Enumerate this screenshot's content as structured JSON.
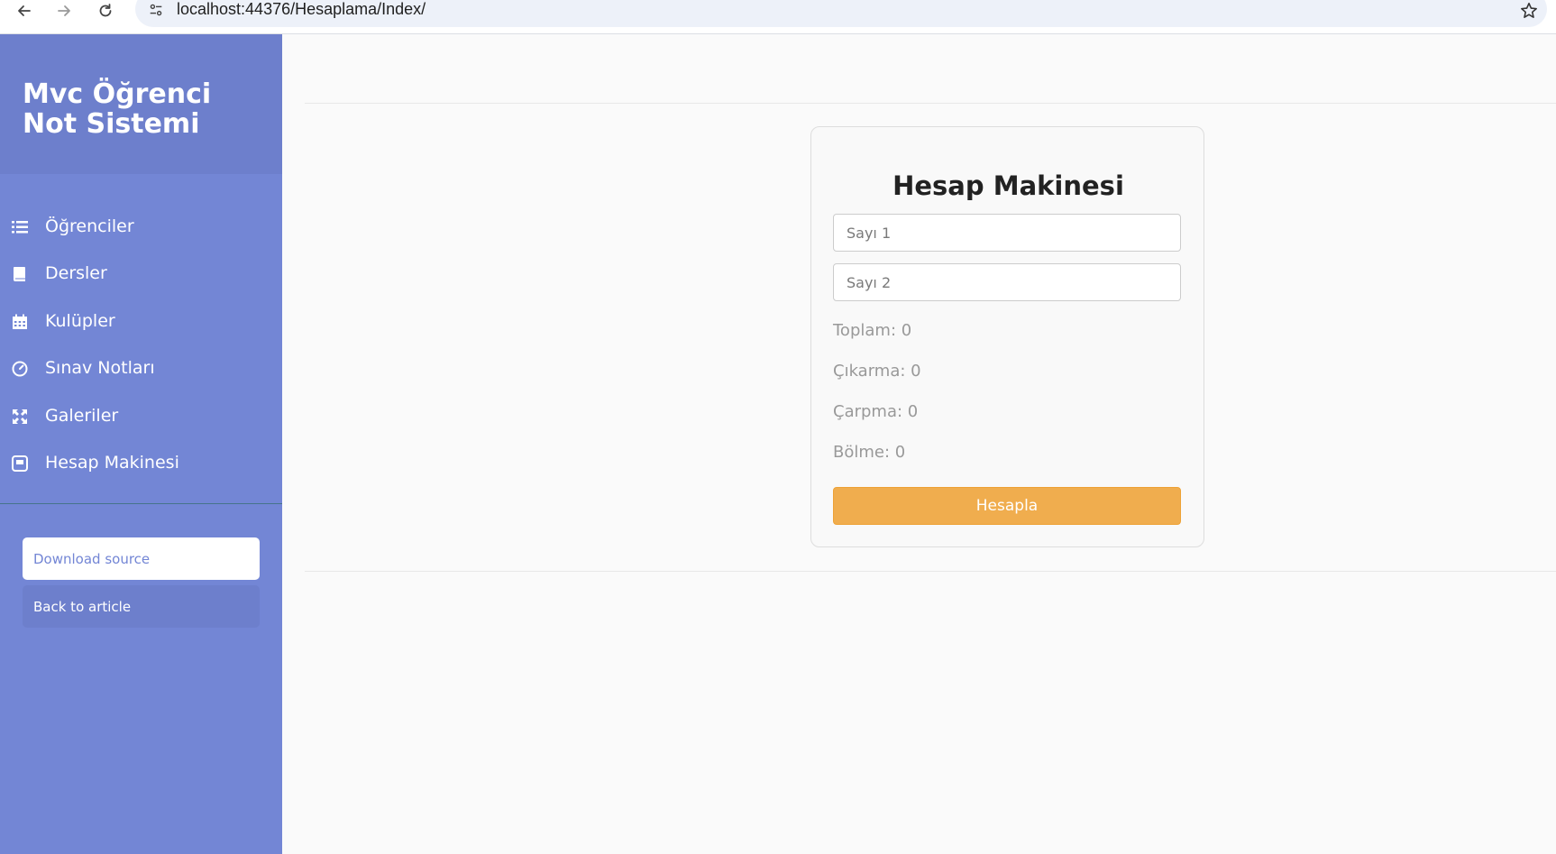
{
  "browser": {
    "url": "localhost:44376/Hesaplama/Index/"
  },
  "sidebar": {
    "title": "Mvc Öğrenci Not Sistemi",
    "items": [
      {
        "label": "Öğrenciler",
        "icon": "list-icon"
      },
      {
        "label": "Dersler",
        "icon": "book-icon"
      },
      {
        "label": "Kulüpler",
        "icon": "calendar-icon"
      },
      {
        "label": "Sınav Notları",
        "icon": "dashboard-icon"
      },
      {
        "label": "Galeriler",
        "icon": "fullscreen-icon"
      },
      {
        "label": "Hesap Makinesi",
        "icon": "calculator-icon"
      }
    ],
    "download_label": "Download source",
    "article_label": "Back to article"
  },
  "calculator": {
    "title": "Hesap Makinesi",
    "input1_placeholder": "Sayı 1",
    "input2_placeholder": "Sayı 2",
    "results": {
      "toplam": "Toplam: 0",
      "cikarma": "Çıkarma: 0",
      "carpma": "Çarpma: 0",
      "bolme": "Bölme: 0"
    },
    "button_label": "Hesapla"
  },
  "colors": {
    "sidebar_bg": "#7386d5",
    "sidebar_header_bg": "#6d7fcc",
    "button_warning": "#f0ad4e"
  }
}
